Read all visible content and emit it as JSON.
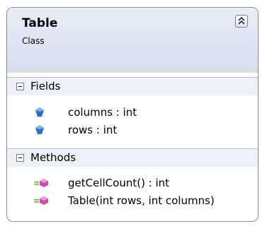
{
  "class": {
    "name": "Table",
    "stereotype": "Class"
  },
  "sections": {
    "fields": {
      "label": "Fields",
      "items": [
        "columns : int",
        "rows : int"
      ]
    },
    "methods": {
      "label": "Methods",
      "items": [
        "getCellCount() : int",
        "Table(int rows, int columns)"
      ]
    }
  },
  "icons": {
    "field": "field-icon",
    "method": "method-icon",
    "collapse": "chevron-double-up-icon",
    "section_toggle": "minus-box-icon"
  },
  "colors": {
    "header_gradient_top": "#e9edf6",
    "header_gradient_bottom": "#d6deee",
    "field_icon": "#2f6fc8",
    "method_icon": "#c64fae",
    "method_icon_lines": "#6fbf3f"
  }
}
